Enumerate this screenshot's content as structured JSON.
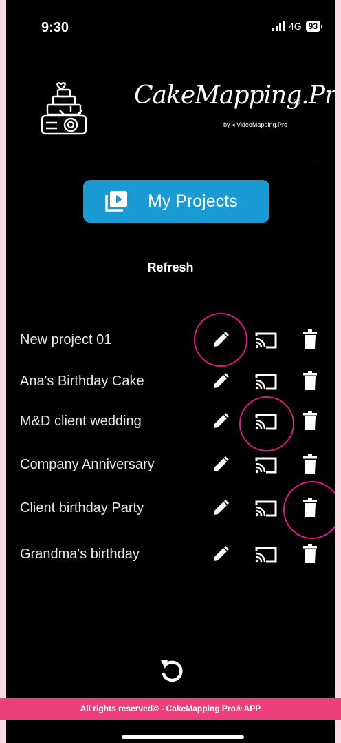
{
  "status": {
    "time": "9:30",
    "network": "4G",
    "battery": "93"
  },
  "brand": {
    "name": "CakeMapping.Pro",
    "mark": "©",
    "by": "by",
    "by_brand": "VideoMapping.Pro"
  },
  "projects_button": {
    "label": "My Projects"
  },
  "refresh_label": "Refresh",
  "projects": [
    {
      "name": "New project 01"
    },
    {
      "name": "Ana's Birthday Cake"
    },
    {
      "name": "M&D client wedding"
    },
    {
      "name": "Company Anniversary"
    },
    {
      "name": "Client birthday Party"
    },
    {
      "name": "Grandma's birthday"
    }
  ],
  "footer": {
    "text": "All rights reserved© - CakeMapping Pro® APP"
  },
  "colors": {
    "accent": "#1a9bd4",
    "highlight": "#e0188a",
    "footer": "#ec3f7c",
    "background": "#000000"
  },
  "icons": [
    "pencil-icon",
    "cast-icon",
    "trash-icon",
    "reload-icon",
    "play-stack-icon",
    "cake-projector-logo"
  ]
}
